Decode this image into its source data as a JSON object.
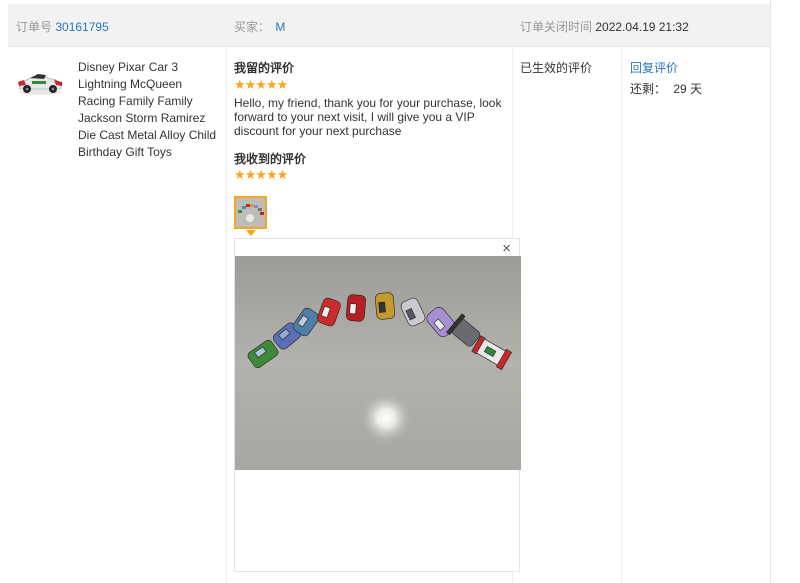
{
  "header": {
    "order_label": "订单号",
    "order_number": "30161795",
    "buyer_label": "买家：",
    "buyer_name": "M",
    "close_time_label": "订单关闭时间",
    "close_time": "2022.04.19 21:32"
  },
  "product": {
    "title": "Disney Pixar Car 3 Lightning McQueen Racing Family Family Jackson Storm Ramirez Die Cast Metal Alloy Child Birthday Gift Toys"
  },
  "my_review": {
    "title": "我留的评价",
    "stars": "★★★★★",
    "rating": 5,
    "text": "Hello, my friend, thank you for your purchase, look forward to your next visit, I will give you a VIP discount for your next purchase"
  },
  "received_review": {
    "title": "我收到的评价",
    "stars": "★★★★★",
    "rating": 5
  },
  "image_viewer": {
    "close_symbol": "×"
  },
  "status": {
    "text": "已生效的评价"
  },
  "actions": {
    "reply_label": "回复评价",
    "remaining_label": "还剩：",
    "remaining_days": "29 天"
  },
  "colors": {
    "link": "#2a76c8",
    "star": "#f5a623",
    "thumb_border": "#f3a622"
  }
}
